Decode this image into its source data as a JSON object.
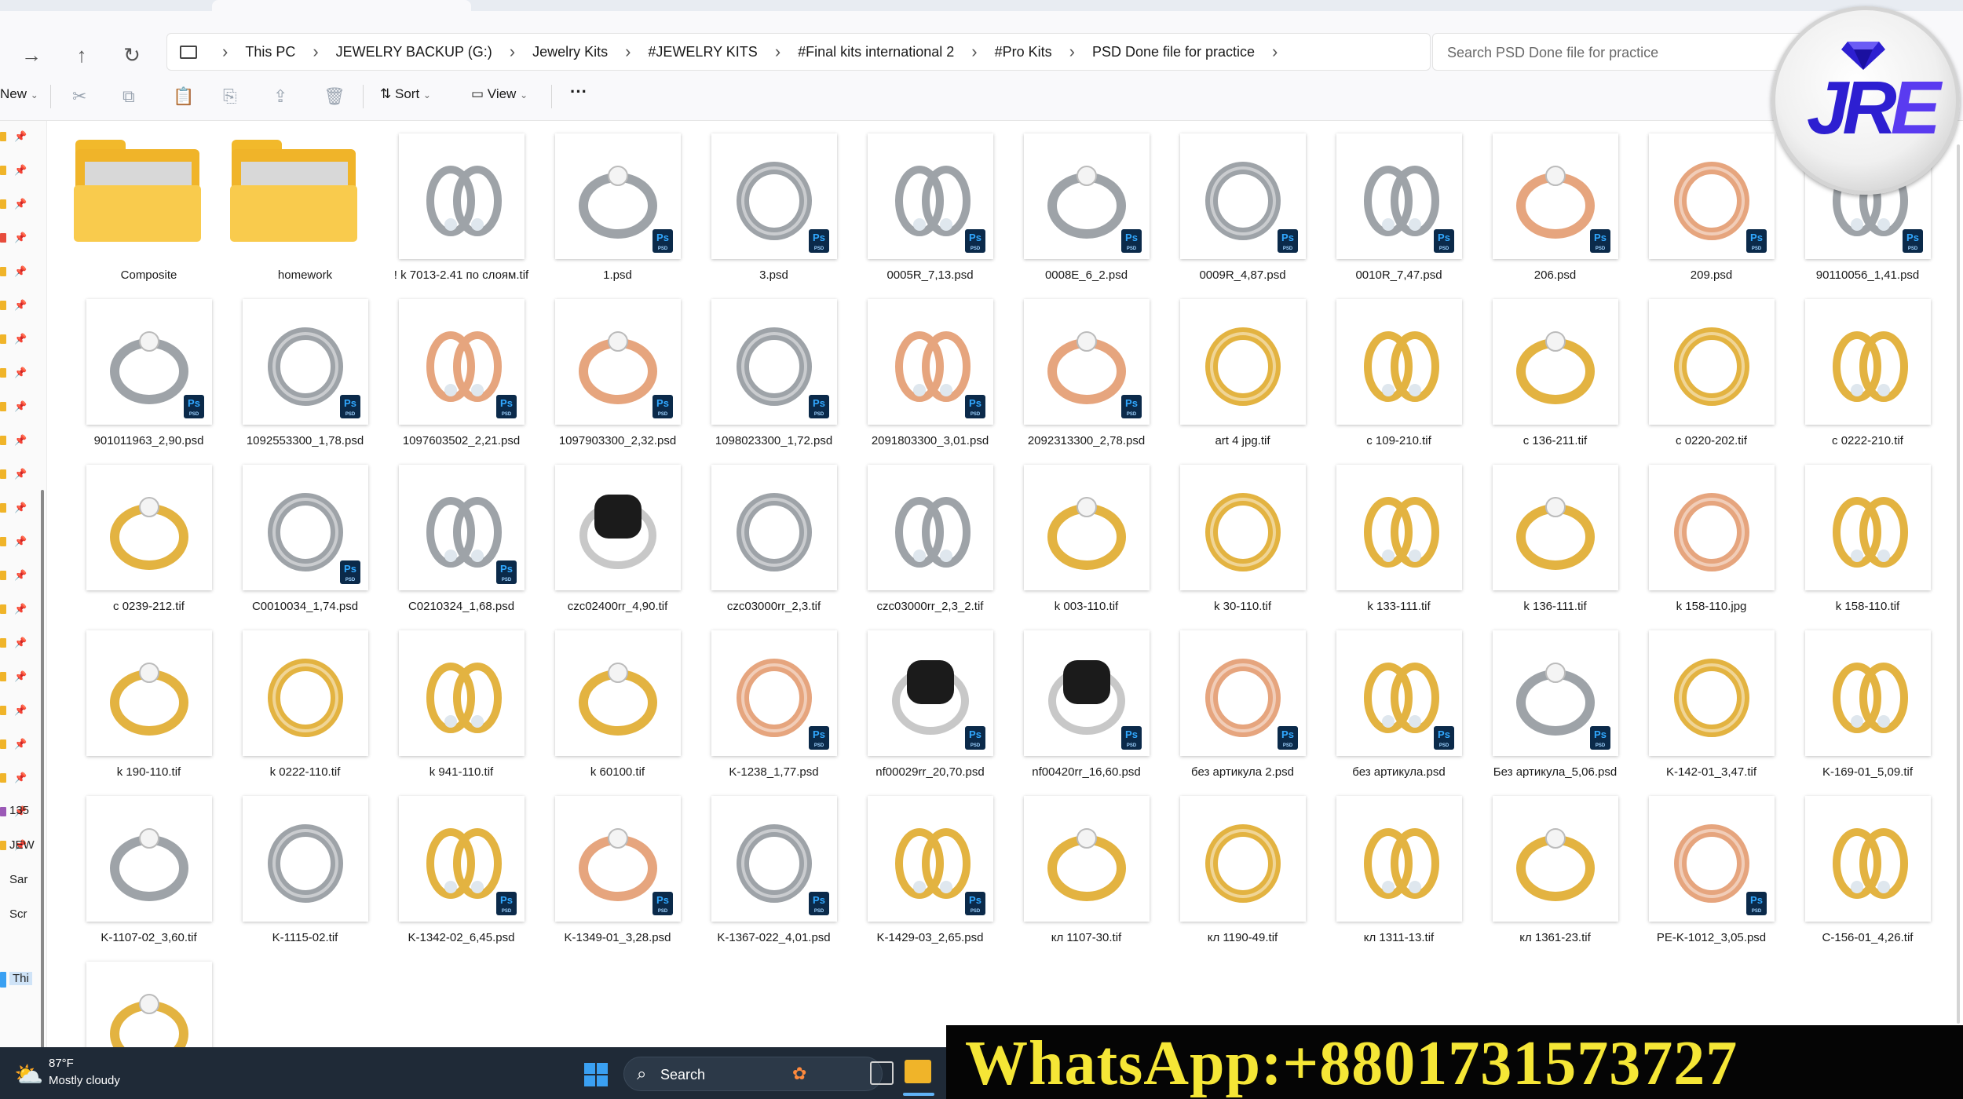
{
  "breadcrumb": [
    "This PC",
    "JEWELRY BACKUP (G:)",
    "Jewelry Kits",
    "#JEWELRY KITS",
    "#Final kits international 2",
    "#Pro Kits",
    "PSD Done file for practice"
  ],
  "search": {
    "placeholder": "Search PSD Done file for practice"
  },
  "toolbar": {
    "new_label": "New",
    "sort_label": "Sort",
    "view_label": "View"
  },
  "nav": {
    "labels": [
      "135",
      "JEW",
      "Sar",
      "Scr",
      "Thi"
    ]
  },
  "files": [
    {
      "name": "Composite",
      "kind": "folder"
    },
    {
      "name": "homework",
      "kind": "folder"
    },
    {
      "name": "! k 7013-2.41 по слоям.tif",
      "kind": "tif",
      "metal": "silver"
    },
    {
      "name": "1.psd",
      "kind": "psd",
      "metal": "silver"
    },
    {
      "name": "3.psd",
      "kind": "psd",
      "metal": "silver"
    },
    {
      "name": "0005R_7,13.psd",
      "kind": "psd",
      "metal": "silver"
    },
    {
      "name": "0008E_6_2.psd",
      "kind": "psd",
      "metal": "silver"
    },
    {
      "name": "0009R_4,87.psd",
      "kind": "psd",
      "metal": "silver"
    },
    {
      "name": "0010R_7,47.psd",
      "kind": "psd",
      "metal": "silver"
    },
    {
      "name": "206.psd",
      "kind": "psd",
      "metal": "rose"
    },
    {
      "name": "209.psd",
      "kind": "psd",
      "metal": "rose"
    },
    {
      "name": "90110056_1,41.psd",
      "kind": "psd",
      "metal": "silver"
    },
    {
      "name": "901011963_2,90.psd",
      "kind": "psd",
      "metal": "silver"
    },
    {
      "name": "1092553300_1,78.psd",
      "kind": "psd",
      "metal": "silver"
    },
    {
      "name": "1097603502_2,21.psd",
      "kind": "psd",
      "metal": "rose"
    },
    {
      "name": "1097903300_2,32.psd",
      "kind": "psd",
      "metal": "rose"
    },
    {
      "name": "1098023300_1,72.psd",
      "kind": "psd",
      "metal": "silver"
    },
    {
      "name": "2091803300_3,01.psd",
      "kind": "psd",
      "metal": "rose"
    },
    {
      "name": "2092313300_2,78.psd",
      "kind": "psd",
      "metal": "rose"
    },
    {
      "name": "art 4 jpg.tif",
      "kind": "tif",
      "metal": "gold"
    },
    {
      "name": "c 109-210.tif",
      "kind": "tif",
      "metal": "gold"
    },
    {
      "name": "c 136-211.tif",
      "kind": "tif",
      "metal": "gold"
    },
    {
      "name": "c 0220-202.tif",
      "kind": "tif",
      "metal": "gold"
    },
    {
      "name": "c 0222-210.tif",
      "kind": "tif",
      "metal": "gold"
    },
    {
      "name": "c 0239-212.tif",
      "kind": "tif",
      "metal": "gold"
    },
    {
      "name": "C0010034_1,74.psd",
      "kind": "psd",
      "metal": "silver"
    },
    {
      "name": "C0210324_1,68.psd",
      "kind": "psd",
      "metal": "silver"
    },
    {
      "name": "czc02400rr_4,90.tif",
      "kind": "tif",
      "metal": "black"
    },
    {
      "name": "czc03000rr_2,3.tif",
      "kind": "tif",
      "metal": "silver"
    },
    {
      "name": "czc03000rr_2,3_2.tif",
      "kind": "tif",
      "metal": "silver"
    },
    {
      "name": "k 003-110.tif",
      "kind": "tif",
      "metal": "gold"
    },
    {
      "name": "k 30-110.tif",
      "kind": "tif",
      "metal": "gold"
    },
    {
      "name": "k 133-111.tif",
      "kind": "tif",
      "metal": "gold"
    },
    {
      "name": "k 136-111.tif",
      "kind": "tif",
      "metal": "gold"
    },
    {
      "name": "k 158-110.jpg",
      "kind": "jpg",
      "metal": "rose"
    },
    {
      "name": "k 158-110.tif",
      "kind": "tif",
      "metal": "gold"
    },
    {
      "name": "k 190-110.tif",
      "kind": "tif",
      "metal": "gold"
    },
    {
      "name": "k 0222-110.tif",
      "kind": "tif",
      "metal": "gold"
    },
    {
      "name": "k 941-110.tif",
      "kind": "tif",
      "metal": "gold"
    },
    {
      "name": "k 60100.tif",
      "kind": "tif",
      "metal": "gold"
    },
    {
      "name": "K-1238_1,77.psd",
      "kind": "psd",
      "metal": "rose"
    },
    {
      "name": "nf00029rr_20,70.psd",
      "kind": "psd",
      "metal": "black"
    },
    {
      "name": "nf00420rr_16,60.psd",
      "kind": "psd",
      "metal": "black"
    },
    {
      "name": "без артикула 2.psd",
      "kind": "psd",
      "metal": "rose"
    },
    {
      "name": "без артикула.psd",
      "kind": "psd",
      "metal": "gold"
    },
    {
      "name": "Без артикула_5,06.psd",
      "kind": "psd",
      "metal": "silver"
    },
    {
      "name": "K-142-01_3,47.tif",
      "kind": "tif",
      "metal": "gold"
    },
    {
      "name": "K-169-01_5,09.tif",
      "kind": "tif",
      "metal": "gold"
    },
    {
      "name": "K-1107-02_3,60.tif",
      "kind": "tif",
      "metal": "silver"
    },
    {
      "name": "K-1115-02.tif",
      "kind": "tif",
      "metal": "silver"
    },
    {
      "name": "K-1342-02_6,45.psd",
      "kind": "psd",
      "metal": "gold"
    },
    {
      "name": "K-1349-01_3,28.psd",
      "kind": "psd",
      "metal": "rose"
    },
    {
      "name": "K-1367-022_4,01.psd",
      "kind": "psd",
      "metal": "silver"
    },
    {
      "name": "K-1429-03_2,65.psd",
      "kind": "psd",
      "metal": "gold"
    },
    {
      "name": "кл 1107-30.tif",
      "kind": "tif",
      "metal": "gold"
    },
    {
      "name": "кл 1190-49.tif",
      "kind": "tif",
      "metal": "gold"
    },
    {
      "name": "кл 1311-13.tif",
      "kind": "tif",
      "metal": "gold"
    },
    {
      "name": "кл 1361-23.tif",
      "kind": "tif",
      "metal": "gold"
    },
    {
      "name": "PE-K-1012_3,05.psd",
      "kind": "psd",
      "metal": "rose"
    },
    {
      "name": "C-156-01_4,26.tif",
      "kind": "tif",
      "metal": "gold"
    },
    {
      "name": "",
      "kind": "tif",
      "metal": "gold"
    }
  ],
  "metal_colors": {
    "silver": "#9ea3a8",
    "gold": "#e3b341",
    "rose": "#e6a57e",
    "black": "#1b1b1b"
  },
  "taskbar": {
    "temperature": "87°F",
    "weather": "Mostly cloudy",
    "search_label": "Search"
  },
  "logo": {
    "text_main": "JR",
    "text_accent": "E"
  },
  "banner": {
    "text": "WhatsApp:+8801731573727"
  }
}
